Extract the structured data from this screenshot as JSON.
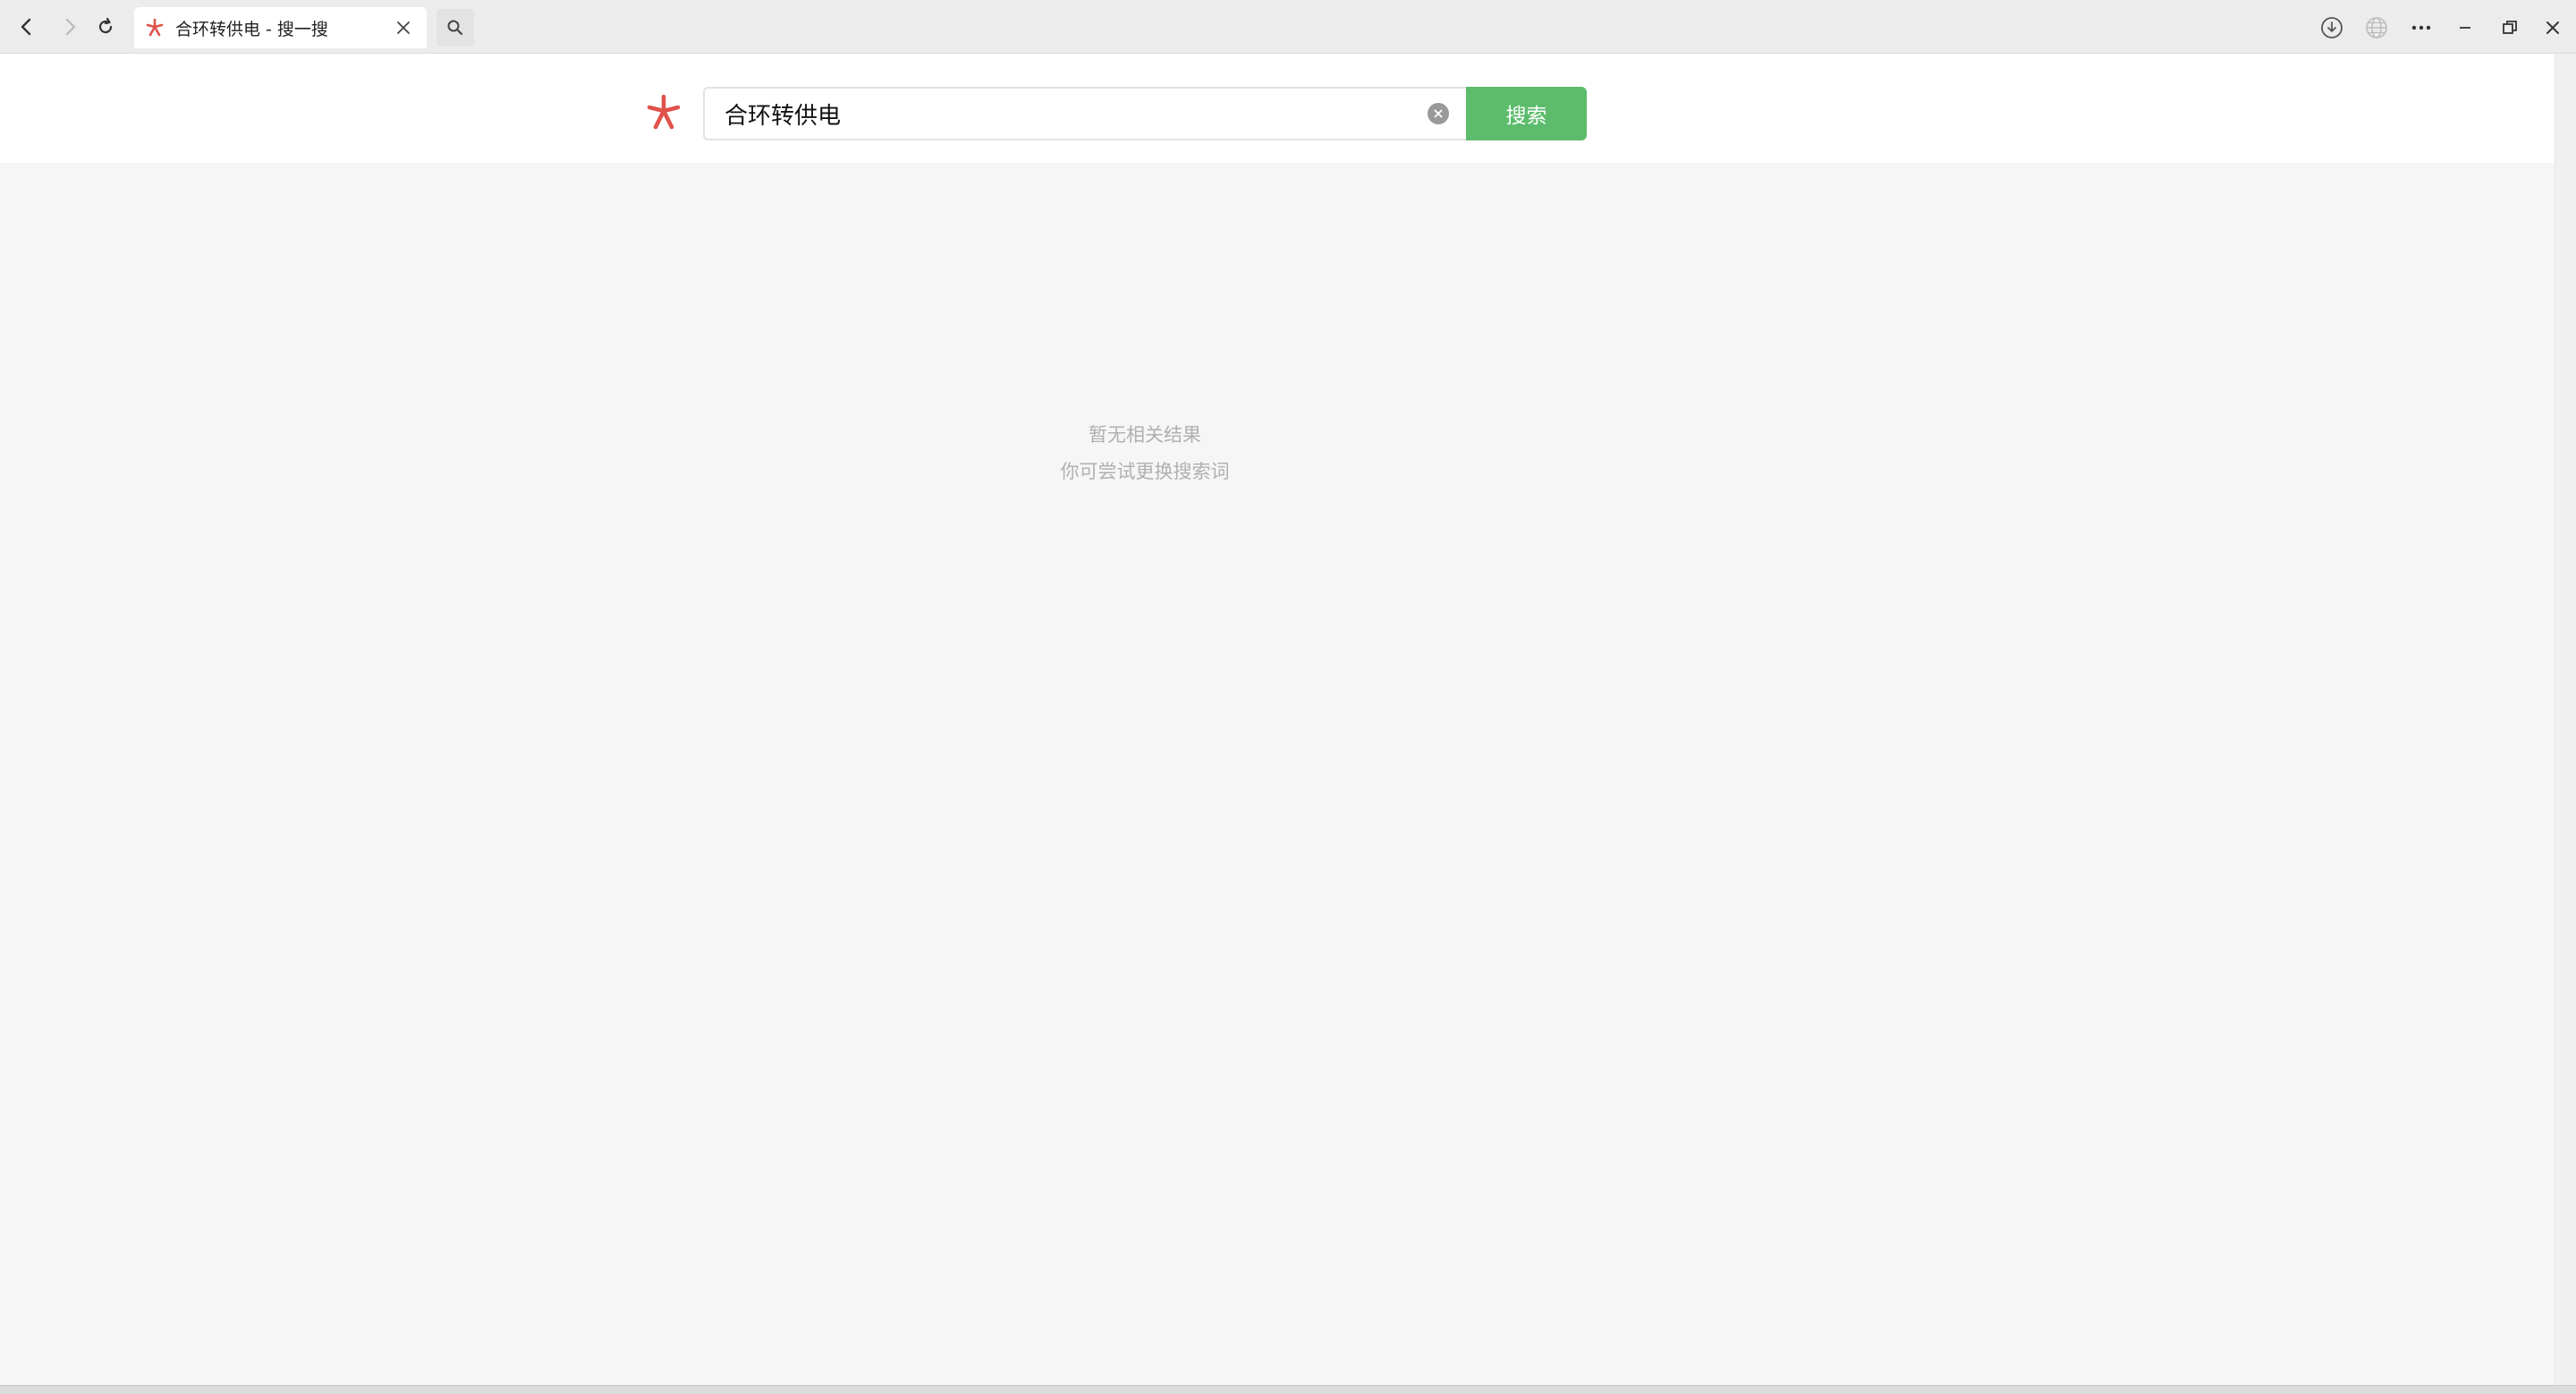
{
  "browser": {
    "tab": {
      "title": "合环转供电 - 搜一搜",
      "favicon": "sogou-star-icon"
    },
    "icons": {
      "back": "back-arrow-icon",
      "forward": "forward-arrow-icon",
      "reload": "reload-icon",
      "tab_close": "close-icon",
      "tab_search": "search-icon",
      "download": "download-icon",
      "globe": "globe-icon",
      "more": "more-icon",
      "minimize": "minimize-icon",
      "restore": "restore-icon",
      "close_window": "close-icon"
    }
  },
  "search": {
    "query": "合环转供电",
    "button_label": "搜索",
    "clear_icon": "clear-icon"
  },
  "results": {
    "empty_title": "暂无相关结果",
    "empty_hint": "你可尝试更换搜索词"
  },
  "colors": {
    "accent_green": "#5cbc6b",
    "logo_red": "#e0524a",
    "muted_text": "#b0b0b0"
  }
}
